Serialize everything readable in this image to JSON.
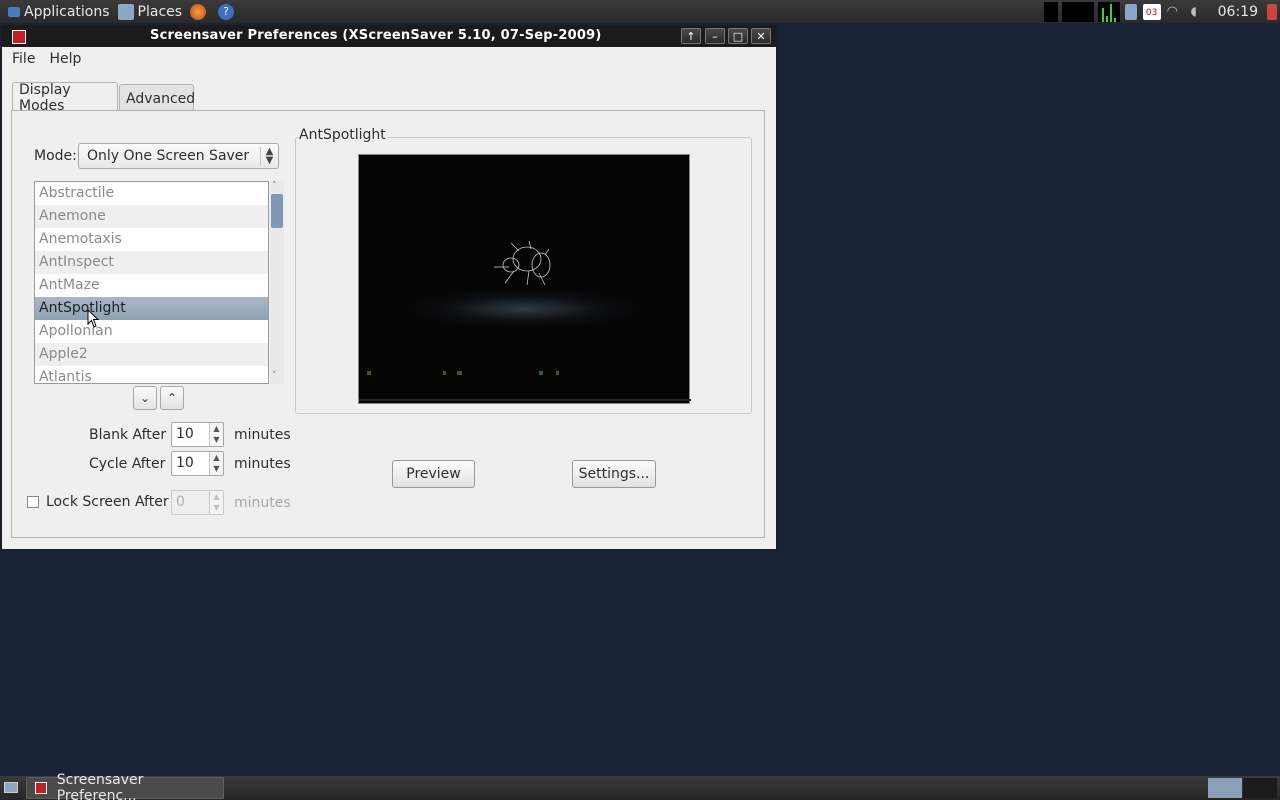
{
  "top_panel": {
    "applications": "Applications",
    "places": "Places",
    "clock": "06:19",
    "calendar_day": "03"
  },
  "window": {
    "title": "Screensaver Preferences  (XScreenSaver 5.10, 07-Sep-2009)",
    "menu": [
      "File",
      "Help"
    ]
  },
  "tabs": [
    "Display Modes",
    "Advanced"
  ],
  "mode": {
    "label": "Mode:",
    "selected": "Only One Screen Saver"
  },
  "savers": [
    "Abstractile",
    "Anemone",
    "Anemotaxis",
    "AntInspect",
    "AntMaze",
    "AntSpotlight",
    "Apollonian",
    "Apple2",
    "Atlantis"
  ],
  "selected_saver": "AntSpotlight",
  "timing": {
    "blank_label": "Blank After",
    "blank_value": "10",
    "cycle_label": "Cycle After",
    "cycle_value": "10",
    "lock_label": "Lock Screen After",
    "lock_value": "0",
    "unit": "minutes",
    "lock_checked": false
  },
  "preview": {
    "frame_label": "AntSpotlight",
    "preview_button": "Preview",
    "settings_button": "Settings..."
  },
  "taskbar": {
    "task_label": "Screensaver Preferenc..."
  }
}
